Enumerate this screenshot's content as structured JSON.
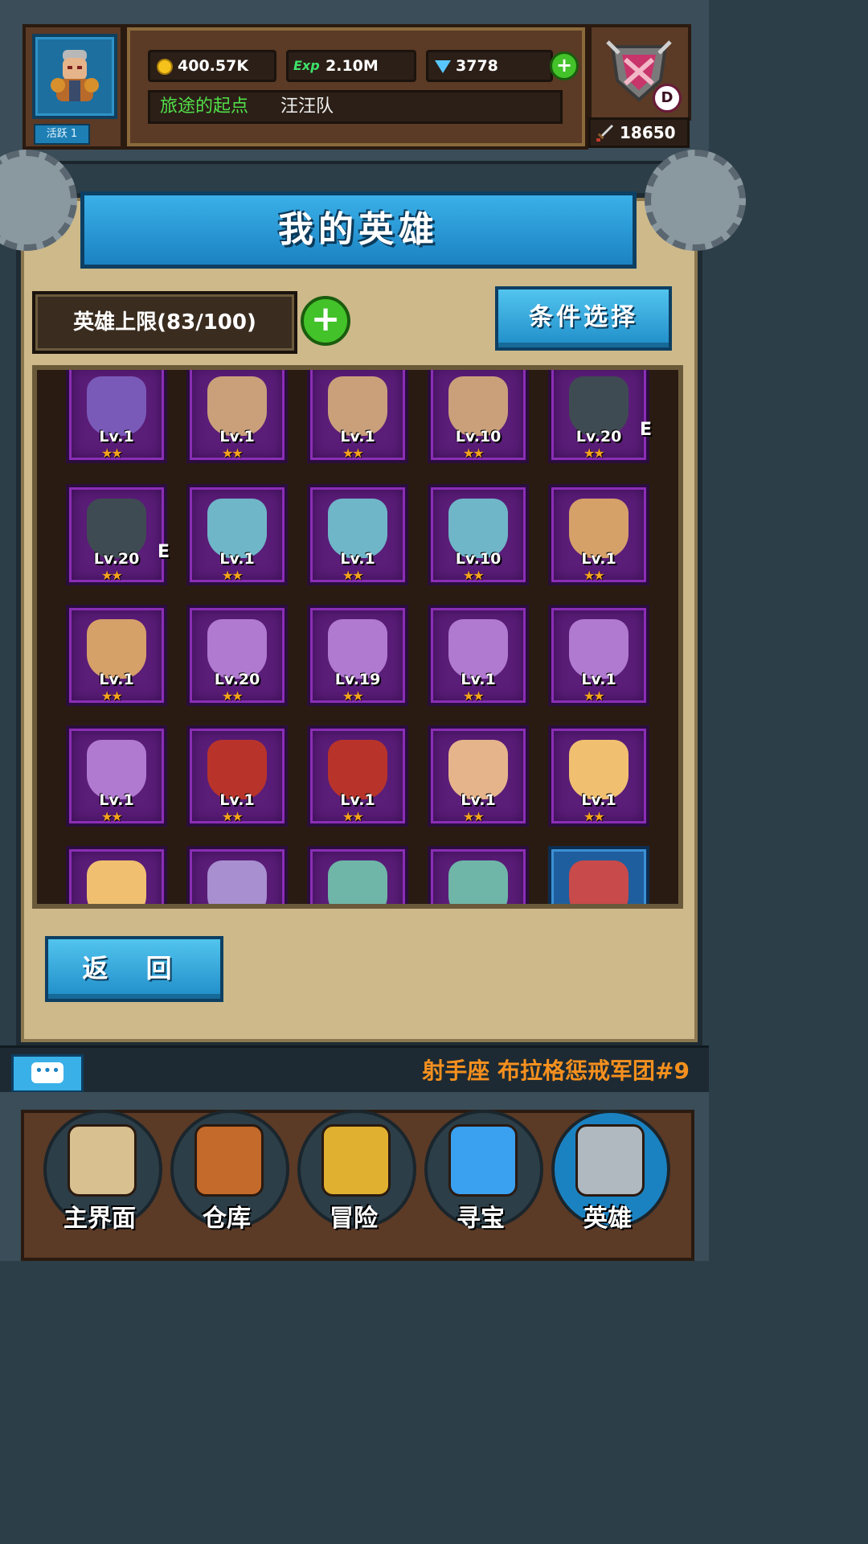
{
  "top": {
    "active_label": "活跃 1",
    "gold": "400.57K",
    "exp_label": "Exp",
    "exp": "2.10M",
    "gems": "3778",
    "player_title": "旅途的起点",
    "team_name": "汪汪队",
    "guild_rank": "D",
    "power": "18650"
  },
  "page": {
    "title": "我的英雄",
    "limit_text": "英雄上限(83/100)",
    "filter_label": "条件选择",
    "back_label": "返 回"
  },
  "heroes": [
    {
      "lv": "Lv.1",
      "stars": "★★",
      "eq": "",
      "icon": "demon-staff-hero-icon",
      "color": "#7a5ab8"
    },
    {
      "lv": "Lv.1",
      "stars": "★★",
      "eq": "",
      "icon": "elder-monk-hero-icon",
      "color": "#c9a07a"
    },
    {
      "lv": "Lv.1",
      "stars": "★★",
      "eq": "",
      "icon": "elder-monk-hero-icon",
      "color": "#c9a07a"
    },
    {
      "lv": "Lv.10",
      "stars": "★★",
      "eq": "",
      "icon": "elder-monk-hero-icon",
      "color": "#c9a07a"
    },
    {
      "lv": "Lv.20",
      "stars": "★★",
      "eq": "E",
      "icon": "goggle-soldier-hero-icon",
      "color": "#3f4b52"
    },
    {
      "lv": "Lv.20",
      "stars": "★★",
      "eq": "E",
      "icon": "goggle-soldier-hero-icon",
      "color": "#3f4b52"
    },
    {
      "lv": "Lv.1",
      "stars": "★★",
      "eq": "",
      "icon": "crowned-sorceress-hero-icon",
      "color": "#6fb6c8"
    },
    {
      "lv": "Lv.1",
      "stars": "★★",
      "eq": "",
      "icon": "crowned-sorceress-hero-icon",
      "color": "#6fb6c8"
    },
    {
      "lv": "Lv.10",
      "stars": "★★",
      "eq": "",
      "icon": "crowned-sorceress-hero-icon",
      "color": "#6fb6c8"
    },
    {
      "lv": "Lv.1",
      "stars": "★★",
      "eq": "",
      "icon": "brawler-hero-icon",
      "color": "#d6a069"
    },
    {
      "lv": "Lv.1",
      "stars": "★★",
      "eq": "",
      "icon": "brawler-hero-icon",
      "color": "#d6a069"
    },
    {
      "lv": "Lv.20",
      "stars": "★★",
      "eq": "",
      "icon": "laurel-fairy-hero-icon",
      "color": "#b07ad0"
    },
    {
      "lv": "Lv.19",
      "stars": "★★",
      "eq": "",
      "icon": "laurel-fairy-hero-icon",
      "color": "#b07ad0"
    },
    {
      "lv": "Lv.1",
      "stars": "★★",
      "eq": "",
      "icon": "laurel-fairy-hero-icon",
      "color": "#b07ad0"
    },
    {
      "lv": "Lv.1",
      "stars": "★★",
      "eq": "",
      "icon": "laurel-fairy-hero-icon",
      "color": "#b07ad0"
    },
    {
      "lv": "Lv.1",
      "stars": "★★",
      "eq": "",
      "icon": "laurel-fairy-hero-icon",
      "color": "#b07ad0"
    },
    {
      "lv": "Lv.1",
      "stars": "★★",
      "eq": "",
      "icon": "fire-warlord-hero-icon",
      "color": "#b8342a"
    },
    {
      "lv": "Lv.1",
      "stars": "★★",
      "eq": "",
      "icon": "fire-warlord-hero-icon",
      "color": "#b8342a"
    },
    {
      "lv": "Lv.1",
      "stars": "★★",
      "eq": "",
      "icon": "pilot-hero-icon",
      "color": "#e6b48a"
    },
    {
      "lv": "Lv.1",
      "stars": "★★",
      "eq": "",
      "icon": "winged-knight-hero-icon",
      "color": "#f0c070"
    },
    {
      "lv": "",
      "stars": "",
      "eq": "",
      "icon": "winged-knight-hero-icon",
      "color": "#f0c070"
    },
    {
      "lv": "",
      "stars": "",
      "eq": "",
      "icon": "silver-valkyrie-hero-icon",
      "color": "#a88fd0"
    },
    {
      "lv": "",
      "stars": "",
      "eq": "",
      "icon": "jade-king-hero-icon",
      "color": "#6fb6a8"
    },
    {
      "lv": "",
      "stars": "",
      "eq": "",
      "icon": "jade-king-hero-icon",
      "color": "#6fb6a8"
    },
    {
      "lv": "",
      "stars": "",
      "eq": "",
      "icon": "witch-hat-hero-icon",
      "color": "#c84a4a",
      "frame": "blue"
    }
  ],
  "ticker": {
    "text": "射手座 布拉格惩戒军团#9"
  },
  "nav": [
    {
      "label": "主界面",
      "icon": "scroll-map-icon",
      "color": "#d8c090"
    },
    {
      "label": "仓库",
      "icon": "treasure-chest-icon",
      "color": "#c46a2a"
    },
    {
      "label": "冒险",
      "icon": "winged-sword-icon",
      "color": "#e0b030"
    },
    {
      "label": "寻宝",
      "icon": "blue-crystal-icon",
      "color": "#3aa0f0"
    },
    {
      "label": "英雄",
      "icon": "knight-helmet-icon",
      "color": "#b0b8c0",
      "active": true
    }
  ],
  "colors": {
    "accent_blue": "#1b82c2",
    "panel": "#cdb98a",
    "card_purple": "#5a1d78",
    "star": "#f6a41b",
    "ticker": "#f5901e",
    "title_green": "#52e04a"
  }
}
